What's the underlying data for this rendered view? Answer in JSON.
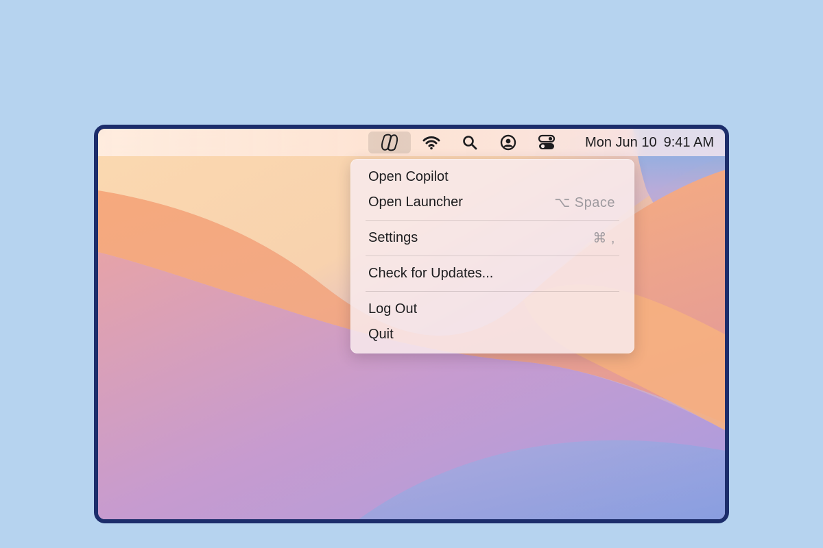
{
  "menubar": {
    "status_icons": [
      "copilot-icon",
      "wifi-icon",
      "search-icon",
      "user-account-icon",
      "control-center-icon"
    ],
    "clock": {
      "date": "Mon Jun 10",
      "time": "9:41 AM"
    }
  },
  "menu": {
    "items": [
      {
        "label": "Open Copilot",
        "shortcut": ""
      },
      {
        "label": "Open Launcher",
        "shortcut": "⌥ Space"
      },
      {
        "label": "Settings",
        "shortcut": "⌘ ,"
      },
      {
        "label": "Check for Updates...",
        "shortcut": ""
      },
      {
        "label": "Log Out",
        "shortcut": ""
      },
      {
        "label": "Quit",
        "shortcut": ""
      }
    ]
  },
  "colors": {
    "page_background": "#b6d3ef",
    "frame_border": "#1c2d6b",
    "wallpaper_peach": "#f3b493",
    "wallpaper_lavender": "#c29ad0",
    "wallpaper_blue": "#7aa3e0"
  }
}
